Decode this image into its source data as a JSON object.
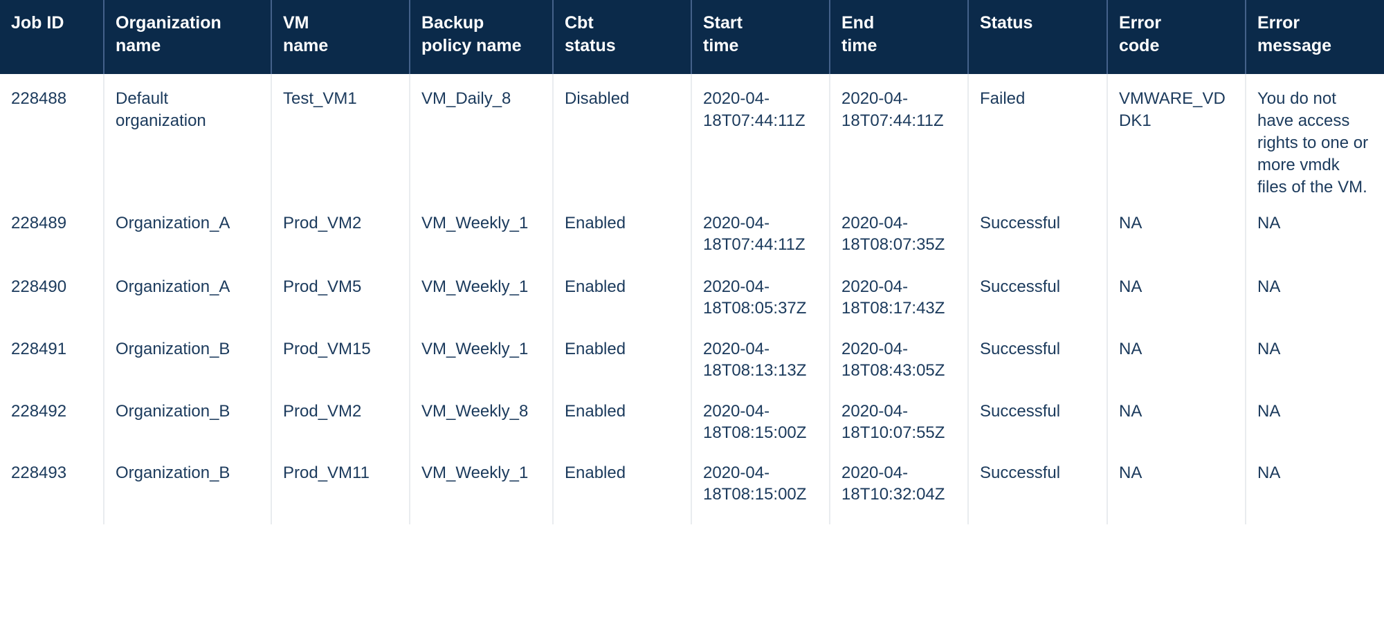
{
  "table": {
    "columns": [
      {
        "id": "job_id",
        "lines": [
          "Job ID"
        ]
      },
      {
        "id": "organization_name",
        "lines": [
          "Organization",
          "name"
        ]
      },
      {
        "id": "vm_name",
        "lines": [
          "VM",
          "name"
        ]
      },
      {
        "id": "backup_policy_name",
        "lines": [
          "Backup",
          "policy name"
        ]
      },
      {
        "id": "cbt_status",
        "lines": [
          "Cbt",
          "status"
        ]
      },
      {
        "id": "start_time",
        "lines": [
          "Start",
          "time"
        ]
      },
      {
        "id": "end_time",
        "lines": [
          "End",
          "time"
        ]
      },
      {
        "id": "status",
        "lines": [
          "Status"
        ]
      },
      {
        "id": "error_code",
        "lines": [
          "Error",
          "code"
        ]
      },
      {
        "id": "error_message",
        "lines": [
          "Error",
          "message"
        ]
      }
    ],
    "rows": [
      {
        "job_id": "228488",
        "organization_name": "Default organization",
        "vm_name": "Test_VM1",
        "backup_policy_name": "VM_Daily_8",
        "cbt_status": "Disabled",
        "start_time": "2020-04-18T07:44:11Z",
        "end_time": "2020-04-18T07:44:11Z",
        "status": "Failed",
        "error_code": "VMWARE_VDDK1",
        "error_message": "You do not have access rights to one or more vmdk files of the VM."
      },
      {
        "job_id": "228489",
        "organization_name": "Organization_A",
        "vm_name": "Prod_VM2",
        "backup_policy_name": "VM_Weekly_1",
        "cbt_status": "Enabled",
        "start_time": "2020-04-18T07:44:11Z",
        "end_time": "2020-04-18T08:07:35Z",
        "status": "Successful",
        "error_code": "NA",
        "error_message": "NA"
      },
      {
        "job_id": "228490",
        "organization_name": "Organization_A",
        "vm_name": "Prod_VM5",
        "backup_policy_name": "VM_Weekly_1",
        "cbt_status": "Enabled",
        "start_time": "2020-04-18T08:05:37Z",
        "end_time": "2020-04-18T08:17:43Z",
        "status": "Successful",
        "error_code": "NA",
        "error_message": "NA"
      },
      {
        "job_id": "228491",
        "organization_name": "Organization_B",
        "vm_name": "Prod_VM15",
        "backup_policy_name": "VM_Weekly_1",
        "cbt_status": "Enabled",
        "start_time": "2020-04-18T08:13:13Z",
        "end_time": "2020-04-18T08:43:05Z",
        "status": "Successful",
        "error_code": "NA",
        "error_message": "NA"
      },
      {
        "job_id": "228492",
        "organization_name": "Organization_B",
        "vm_name": "Prod_VM2",
        "backup_policy_name": "VM_Weekly_8",
        "cbt_status": "Enabled",
        "start_time": "2020-04-18T08:15:00Z",
        "end_time": "2020-04-18T10:07:55Z",
        "status": "Successful",
        "error_code": "NA",
        "error_message": "NA"
      },
      {
        "job_id": "228493",
        "organization_name": "Organization_B",
        "vm_name": "Prod_VM11",
        "backup_policy_name": "VM_Weekly_1",
        "cbt_status": "Enabled",
        "start_time": "2020-04-18T08:15:00Z",
        "end_time": "2020-04-18T10:32:04Z",
        "status": "Successful",
        "error_code": "NA",
        "error_message": "NA"
      }
    ]
  },
  "colors": {
    "header_background": "#0b2a4a",
    "header_text": "#ffffff",
    "header_divider": "#44618a",
    "body_text": "#1b3a5c",
    "body_divider": "#e9ecef",
    "page_background": "#ffffff"
  }
}
